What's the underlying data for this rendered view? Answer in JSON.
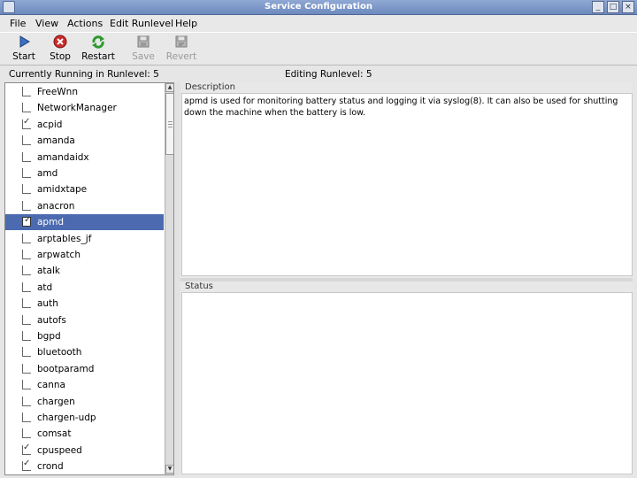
{
  "window": {
    "title": "Service Configuration"
  },
  "menu": [
    "File",
    "View",
    "Actions",
    "Edit Runlevel",
    "Help"
  ],
  "toolbar": {
    "start": "Start",
    "stop": "Stop",
    "restart": "Restart",
    "save": "Save",
    "revert": "Revert"
  },
  "runlevel": {
    "current": "Currently Running in Runlevel: 5",
    "editing": "Editing Runlevel: 5"
  },
  "services": [
    {
      "name": "FreeWnn",
      "checked": false
    },
    {
      "name": "NetworkManager",
      "checked": false
    },
    {
      "name": "acpid",
      "checked": true
    },
    {
      "name": "amanda",
      "checked": false
    },
    {
      "name": "amandaidx",
      "checked": false
    },
    {
      "name": "amd",
      "checked": false
    },
    {
      "name": "amidxtape",
      "checked": false
    },
    {
      "name": "anacron",
      "checked": false
    },
    {
      "name": "apmd",
      "checked": true,
      "selected": true
    },
    {
      "name": "arptables_jf",
      "checked": false
    },
    {
      "name": "arpwatch",
      "checked": false
    },
    {
      "name": "atalk",
      "checked": false
    },
    {
      "name": "atd",
      "checked": false
    },
    {
      "name": "auth",
      "checked": false
    },
    {
      "name": "autofs",
      "checked": false
    },
    {
      "name": "bgpd",
      "checked": false
    },
    {
      "name": "bluetooth",
      "checked": false
    },
    {
      "name": "bootparamd",
      "checked": false
    },
    {
      "name": "canna",
      "checked": false
    },
    {
      "name": "chargen",
      "checked": false
    },
    {
      "name": "chargen-udp",
      "checked": false
    },
    {
      "name": "comsat",
      "checked": false
    },
    {
      "name": "cpuspeed",
      "checked": true
    },
    {
      "name": "crond",
      "checked": true
    }
  ],
  "description": {
    "label": "Description",
    "text": "apmd is used for monitoring battery status and logging it via syslog(8). It can also be used for shutting down the machine when the battery is low."
  },
  "status": {
    "label": "Status",
    "text": ""
  },
  "colors": {
    "selection": "#4b6ab0",
    "titlebar": "#7f98c8",
    "start": "#3a6fc4",
    "stop": "#cc2a2a",
    "restart": "#2f9a2f"
  }
}
